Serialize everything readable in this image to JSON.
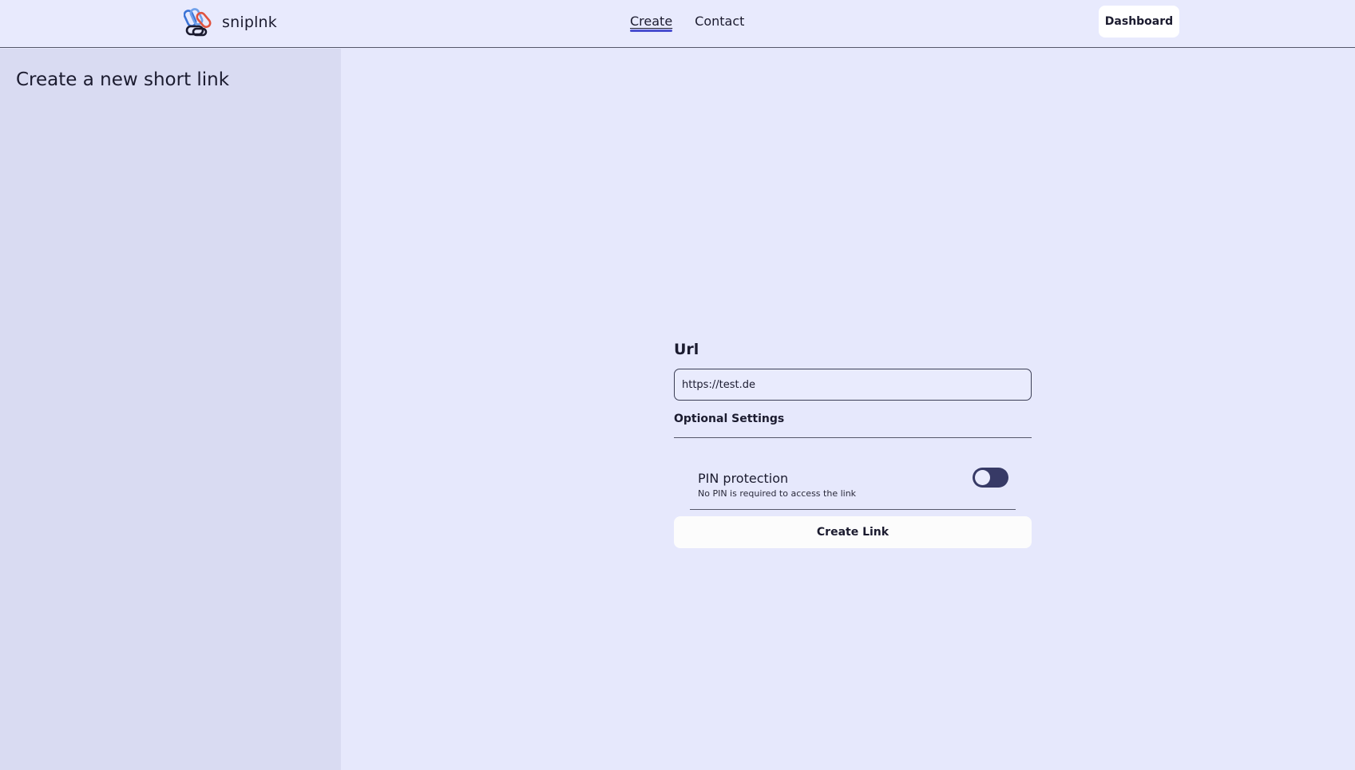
{
  "header": {
    "brand": "sniplnk",
    "logo_icon": "chain-link-icon",
    "nav": [
      {
        "label": "Create",
        "active": true
      },
      {
        "label": "Contact",
        "active": false
      }
    ],
    "dashboard_label": "Dashboard"
  },
  "sidebar": {
    "title": "Create a new short link"
  },
  "form": {
    "url_label": "Url",
    "url_value": "https://test.de",
    "optional_settings_label": "Optional Settings",
    "pin": {
      "title": "PIN protection",
      "description": "No PIN is required to access the link",
      "enabled": false
    },
    "submit_label": "Create Link"
  },
  "colors": {
    "background": "#e6e8fc",
    "sidebar": "#d9dbf2",
    "toggle_track": "#373a66",
    "nav_underline": "#4a4fd0"
  }
}
